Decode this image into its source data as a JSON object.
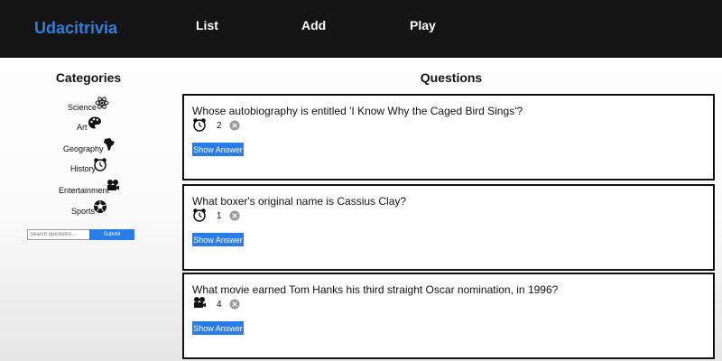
{
  "navbar": {
    "brand": "Udacitrivia",
    "links": [
      {
        "label": "List"
      },
      {
        "label": "Add"
      },
      {
        "label": "Play"
      }
    ]
  },
  "categories_panel": {
    "title": "Categories",
    "items": [
      {
        "label": "Science",
        "icon": "atom-icon"
      },
      {
        "label": "Art",
        "icon": "palette-icon"
      },
      {
        "label": "Geography",
        "icon": "africa-map-icon"
      },
      {
        "label": "History",
        "icon": "alarm-clock-icon"
      },
      {
        "label": "Entertainment",
        "icon": "film-camera-icon"
      },
      {
        "label": "Sports",
        "icon": "soccer-ball-icon"
      }
    ],
    "search": {
      "placeholder": "Search questions...",
      "submit_label": "Submit"
    }
  },
  "questions_panel": {
    "title": "Questions",
    "questions": [
      {
        "text": "Whose autobiography is entitled 'I Know Why the Caged Bird Sings'?",
        "category_icon": "alarm-clock-icon",
        "difficulty": "2",
        "show_answer_label": "Show Answer"
      },
      {
        "text": "What boxer's original name is Cassius Clay?",
        "category_icon": "alarm-clock-icon",
        "difficulty": "1",
        "show_answer_label": "Show Answer"
      },
      {
        "text": "What movie earned Tom Hanks his third straight Oscar nomination, in 1996?",
        "category_icon": "film-camera-icon",
        "difficulty": "4",
        "show_answer_label": "Show Answer"
      }
    ]
  },
  "colors": {
    "navbar": "#141414",
    "brand": "#2f7fd8",
    "button": "#2b7ce6"
  }
}
